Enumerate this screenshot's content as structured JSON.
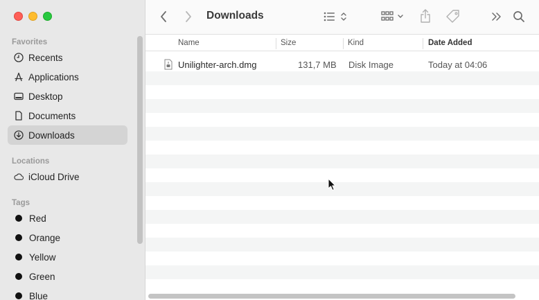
{
  "window": {
    "title": "Downloads"
  },
  "sidebar": {
    "favorites_label": "Favorites",
    "favorites": [
      {
        "label": "Recents",
        "icon": "clock-icon"
      },
      {
        "label": "Applications",
        "icon": "applications-icon"
      },
      {
        "label": "Desktop",
        "icon": "desktop-icon"
      },
      {
        "label": "Documents",
        "icon": "document-icon"
      },
      {
        "label": "Downloads",
        "icon": "download-icon",
        "selected": true
      }
    ],
    "locations_label": "Locations",
    "locations": [
      {
        "label": "iCloud Drive",
        "icon": "cloud-icon"
      }
    ],
    "tags_label": "Tags",
    "tags": [
      {
        "label": "Red"
      },
      {
        "label": "Orange"
      },
      {
        "label": "Yellow"
      },
      {
        "label": "Green"
      },
      {
        "label": "Blue"
      }
    ]
  },
  "columns": {
    "name": "Name",
    "size": "Size",
    "kind": "Kind",
    "date_added": "Date Added"
  },
  "files": [
    {
      "name": "Unilighter-arch.dmg",
      "size": "131,7 MB",
      "kind": "Disk Image",
      "date_added": "Today at 04:06"
    }
  ],
  "colors": {
    "sidebar_bg": "#e8e8e8",
    "selected_bg": "#d4d4d4",
    "stripe": "#f4f5f5"
  }
}
